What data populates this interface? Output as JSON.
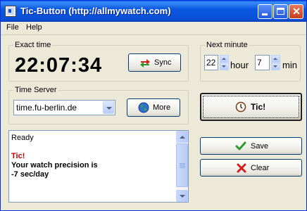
{
  "window": {
    "title": "Tic-Button (http://allmywatch.com)"
  },
  "menu": {
    "file": "File",
    "help": "Help"
  },
  "exact_time": {
    "label": "Exact time",
    "value": "22:07:34",
    "sync_label": "Sync"
  },
  "next_minute": {
    "label": "Next minute",
    "hour_value": "22",
    "hour_unit": "hour",
    "min_value": "7",
    "min_unit": "min"
  },
  "time_server": {
    "label": "Time Server",
    "selected": "time.fu-berlin.de",
    "more_label": "More"
  },
  "tic_button": {
    "label": "Tic!"
  },
  "log": {
    "lines": [
      "Ready",
      "",
      "Tic!",
      "Your watch precision is",
      "-7 sec/day"
    ]
  },
  "actions": {
    "save_label": "Save",
    "clear_label": "Clear"
  },
  "colors": {
    "titlebar": "#0A58E0",
    "tic_text": "#C00000",
    "face": "#ECE9D8"
  }
}
